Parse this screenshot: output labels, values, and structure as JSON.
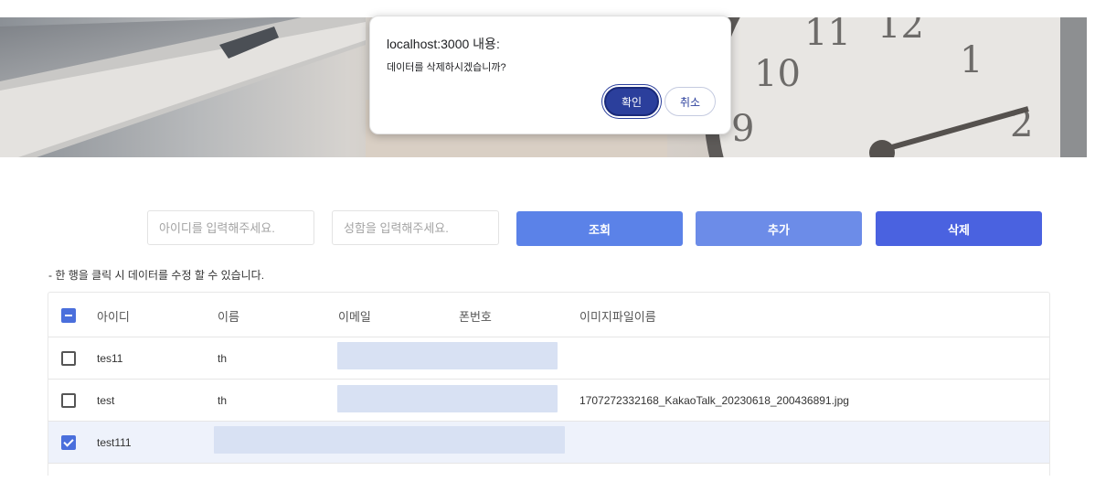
{
  "dialog": {
    "title": "localhost:3000 내용:",
    "message": "데이터를 삭제하시겠습니까?",
    "ok_label": "확인",
    "cancel_label": "취소"
  },
  "filters": {
    "id_placeholder": "아이디를 입력해주세요.",
    "name_placeholder": "성함을 입력해주세요."
  },
  "buttons": {
    "search": "조회",
    "add": "추가",
    "delete": "삭제"
  },
  "hint": "- 한 행을 클릭 시 데이터를 수정 할 수 있습니다.",
  "table": {
    "columns": [
      "아이디",
      "이름",
      "이메일",
      "폰번호",
      "이미지파일이름"
    ],
    "rows": [
      {
        "checked": false,
        "id": "tes11",
        "name": "th",
        "email": "",
        "phone": "",
        "image": ""
      },
      {
        "checked": false,
        "id": "test",
        "name": "th",
        "email": "",
        "phone": "",
        "image": "1707272332168_KakaoTalk_20230618_200436891.jpg"
      },
      {
        "checked": true,
        "id": "test111",
        "name": "",
        "email": "",
        "phone": "",
        "image": ""
      }
    ]
  },
  "colors": {
    "primary": "#4a62e0",
    "search_button": "#5b82e8",
    "add_button": "#6c8ce8",
    "dialog_ok": "#2b3f9c",
    "selected_row": "#eef2fb",
    "edit_field": "#d8e1f3"
  }
}
